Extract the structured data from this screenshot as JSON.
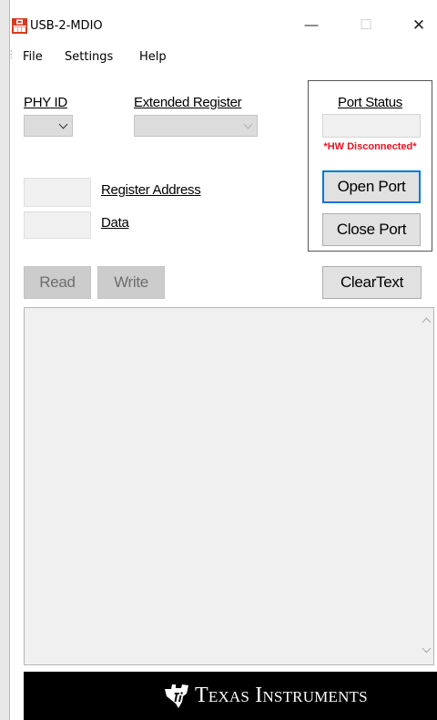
{
  "window": {
    "title": "USB-2-MDIO",
    "minimize_glyph": "—",
    "maximize_glyph": "☐",
    "close_glyph": "✕",
    "icon": "usb-mdio-app-icon"
  },
  "menu": {
    "items": [
      {
        "label": "File"
      },
      {
        "label": "Settings"
      },
      {
        "label": "Help"
      }
    ]
  },
  "phy": {
    "label": "PHY ID",
    "selected": ""
  },
  "extended_register": {
    "label": "Extended Register",
    "selected": ""
  },
  "register_address": {
    "label": "Register Address",
    "value": ""
  },
  "data_field": {
    "label": "Data",
    "value": ""
  },
  "port": {
    "title": "Port Status",
    "status_value": "",
    "hw_status": "*HW Disconnected*",
    "open_label": "Open Port",
    "close_label": "Close Port"
  },
  "actions": {
    "read_label": "Read",
    "write_label": "Write",
    "clear_label": "ClearText"
  },
  "output": {
    "text": ""
  },
  "footer": {
    "brand": "Texas Instruments",
    "logo_icon": "ti-logo-icon"
  },
  "colors": {
    "accent": "#0078d7",
    "error": "#e81123",
    "footer_bg": "#000000"
  }
}
